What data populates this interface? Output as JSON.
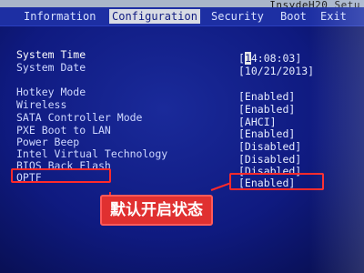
{
  "header": {
    "brand": "InsydeH20 Setu"
  },
  "menu": {
    "tabs": [
      {
        "label": "Information"
      },
      {
        "label": "Configuration"
      },
      {
        "label": "Security"
      },
      {
        "label": "Boot"
      },
      {
        "label": "Exit"
      }
    ],
    "active": "Configuration"
  },
  "settings": [
    {
      "label": "System Time",
      "value_cursor": "1",
      "value_rest": "4:08:03]",
      "value_prefix": "["
    },
    {
      "label": "System Date",
      "value": "[10/21/2013]"
    },
    {
      "label": "Hotkey Mode",
      "value": "[Enabled]"
    },
    {
      "label": "Wireless",
      "value": "[Enabled]"
    },
    {
      "label": "SATA Controller Mode",
      "value": "[AHCI]"
    },
    {
      "label": "PXE Boot to LAN",
      "value": "[Enabled]"
    },
    {
      "label": "Power Beep",
      "value": "[Disabled]"
    },
    {
      "label": "Intel Virtual Technology",
      "value": "[Disabled]"
    },
    {
      "label": "BIOS Back Flash",
      "value": "[Disabled]"
    },
    {
      "label": "OPTF",
      "value": "[Enabled]"
    }
  ],
  "annotation": {
    "text": "默认开启状态",
    "color": "#e03030"
  }
}
